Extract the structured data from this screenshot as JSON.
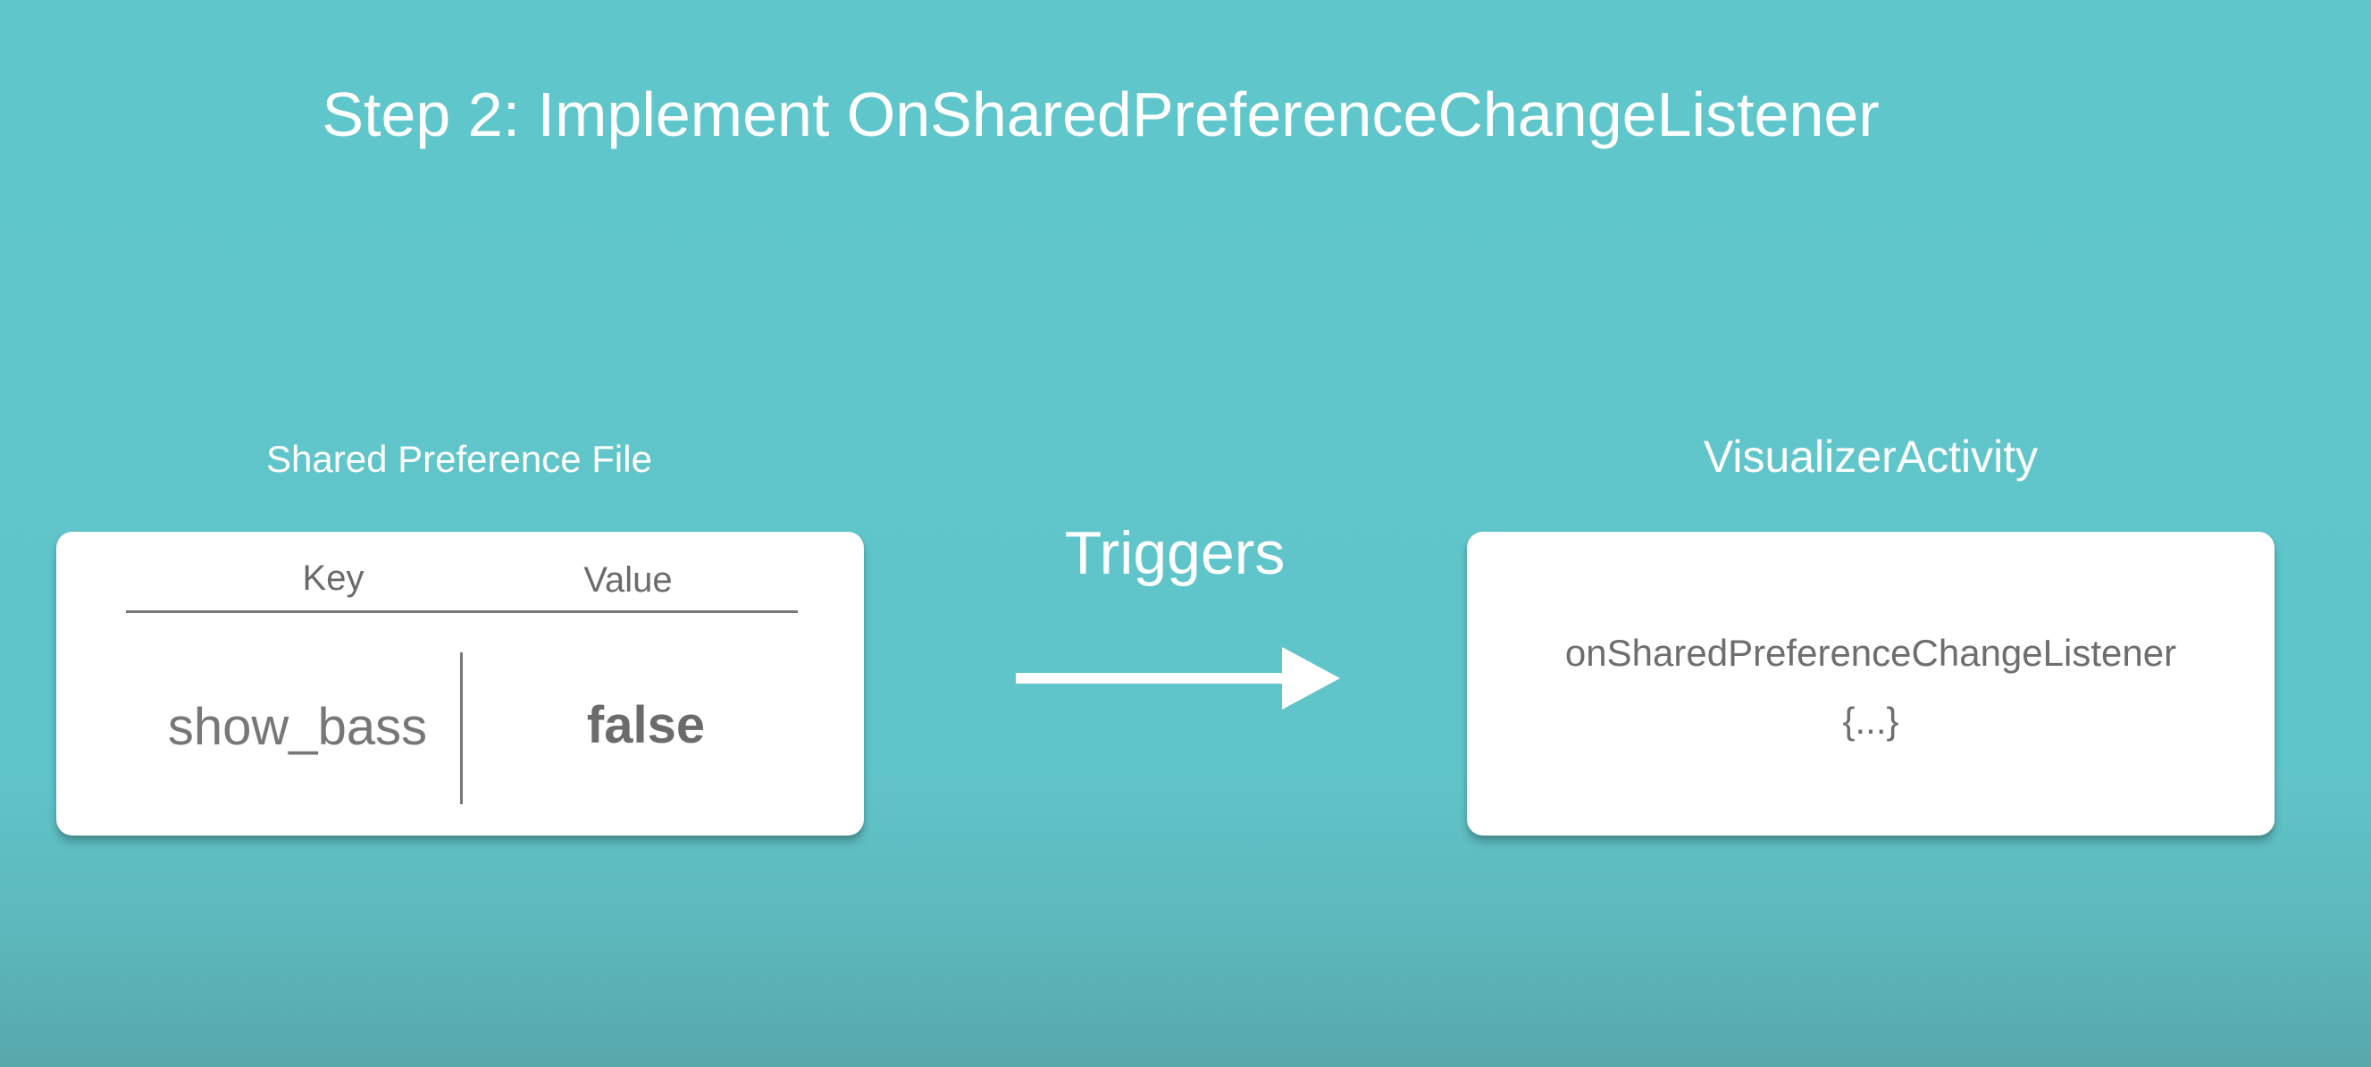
{
  "title": "Step 2:  Implement OnSharedPreferenceChangeListener",
  "left_panel": {
    "caption": "Shared Preference File",
    "columns": {
      "key": "Key",
      "value": "Value"
    },
    "row": {
      "key": "show_bass",
      "value": "false"
    }
  },
  "connector": {
    "label": "Triggers",
    "icon": "right-arrow-icon"
  },
  "right_panel": {
    "caption": "VisualizerActivity",
    "method_name": "onSharedPreferenceChangeListener",
    "method_body": "{...}"
  },
  "colors": {
    "background": "#5fc6cb",
    "card": "#ffffff",
    "card_text": "#6b6b6b",
    "title_text": "#ffffff"
  }
}
